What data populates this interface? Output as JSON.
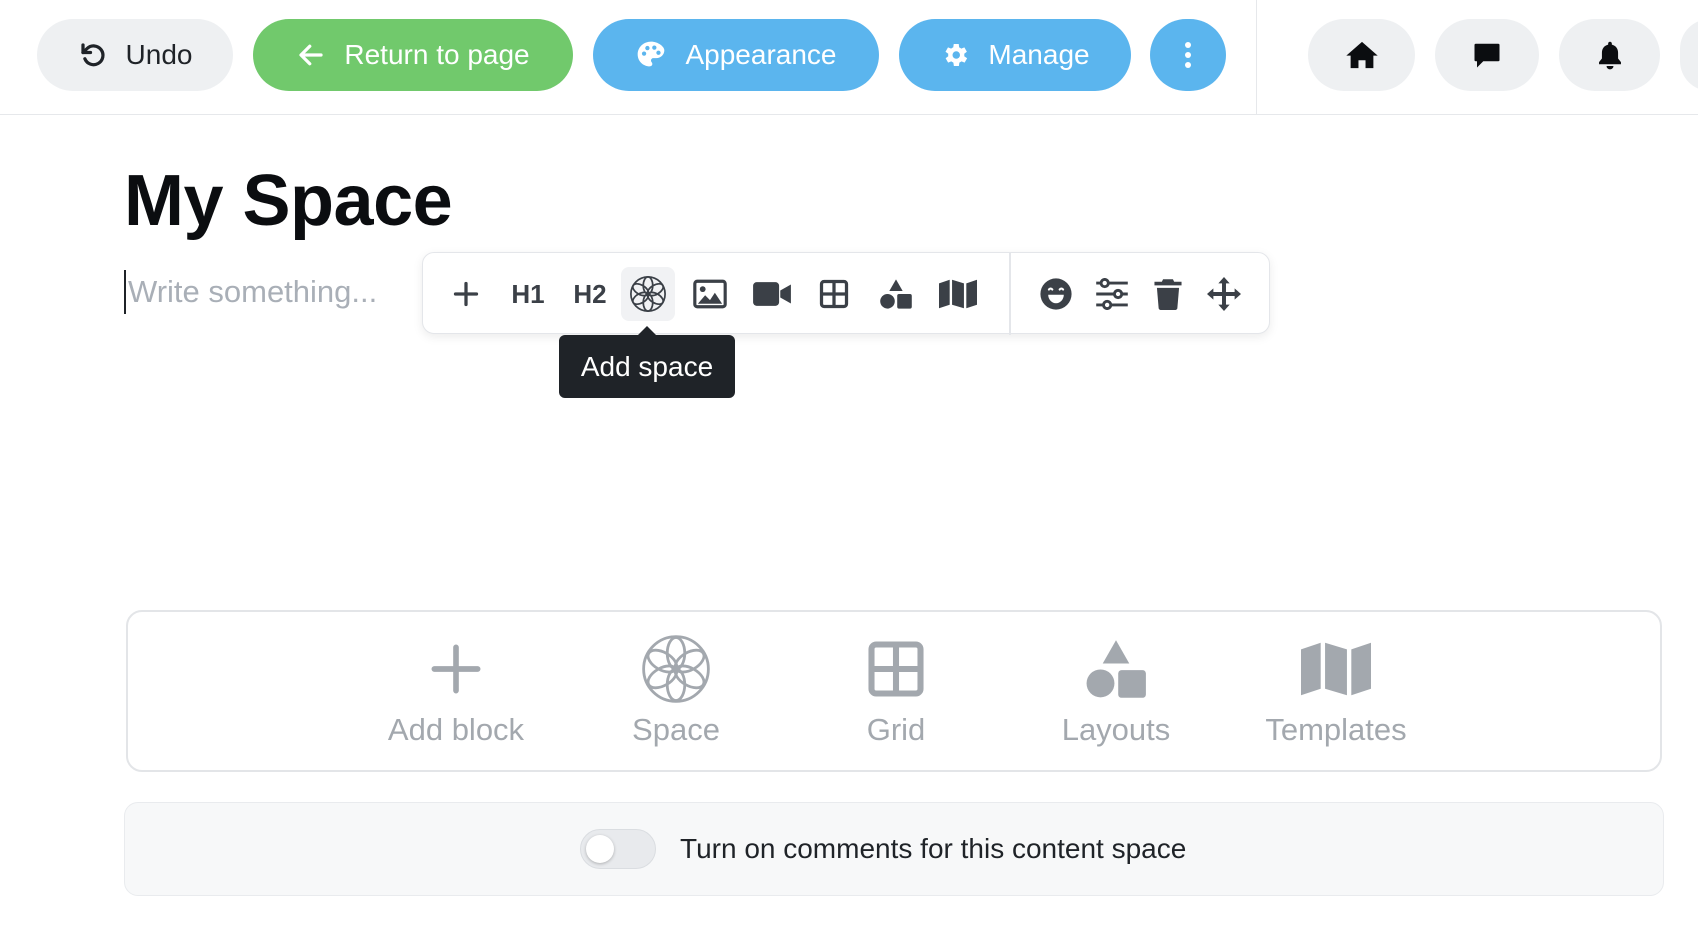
{
  "topbar": {
    "undo_label": "Undo",
    "return_label": "Return to page",
    "appearance_label": "Appearance",
    "manage_label": "Manage",
    "icons": [
      "undo-icon",
      "arrow-left-icon",
      "palette-icon",
      "gear-icon",
      "more-vertical-icon",
      "home-icon",
      "chat-icon",
      "bell-icon"
    ]
  },
  "page": {
    "title": "My Space",
    "editor_placeholder": "Write something..."
  },
  "toolbar": {
    "h1_label": "H1",
    "h2_label": "H2",
    "tooltip": "Add space",
    "icons": [
      "plus-icon",
      "space-icon",
      "image-icon",
      "video-icon",
      "grid-icon",
      "shapes-icon",
      "map-icon",
      "emoji-icon",
      "sliders-icon",
      "trash-icon",
      "move-icon"
    ]
  },
  "block_panel": {
    "items": [
      {
        "label": "Add block",
        "icon": "plus-icon"
      },
      {
        "label": "Space",
        "icon": "space-icon"
      },
      {
        "label": "Grid",
        "icon": "grid-icon"
      },
      {
        "label": "Layouts",
        "icon": "shapes-icon"
      },
      {
        "label": "Templates",
        "icon": "map-icon"
      }
    ]
  },
  "comments": {
    "label": "Turn on comments for this content space",
    "enabled": false
  },
  "colors": {
    "green": "#71c96c",
    "blue": "#5bb5ee",
    "gray_pill": "#eef0f2",
    "tooltip_bg": "#1f2328",
    "muted_icon": "#a3a8ae"
  }
}
